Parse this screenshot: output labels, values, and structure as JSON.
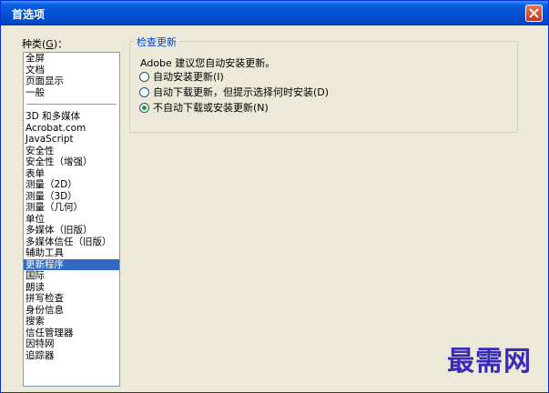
{
  "window": {
    "title": "首选项"
  },
  "categories": {
    "label_prefix": "种类(",
    "label_mnemonic": "G",
    "label_suffix": ")：",
    "group1": [
      "全屏",
      "文档",
      "页面显示",
      "一般"
    ],
    "group2": [
      "3D 和多媒体",
      "Acrobat.com",
      "JavaScript",
      "安全性",
      "安全性（增强）",
      "表单",
      "测量（2D）",
      "测量（3D）",
      "测量（几何）",
      "单位",
      "多媒体（旧版）",
      "多媒体信任（旧版）",
      "辅助工具",
      "更新程序",
      "国际",
      "朗读",
      "拼写检查",
      "身份信息",
      "搜索",
      "信任管理器",
      "因特网",
      "追踪器"
    ],
    "selected": "更新程序"
  },
  "update": {
    "group_title": "检查更新",
    "description": "Adobe 建议您自动安装更新。",
    "options": [
      {
        "label": "自动安装更新(I)",
        "checked": false
      },
      {
        "label": "自动下载更新，但提示选择何时安装(D)",
        "checked": false
      },
      {
        "label": "不自动下载或安装更新(N)",
        "checked": true
      }
    ]
  },
  "watermark": "最需网"
}
